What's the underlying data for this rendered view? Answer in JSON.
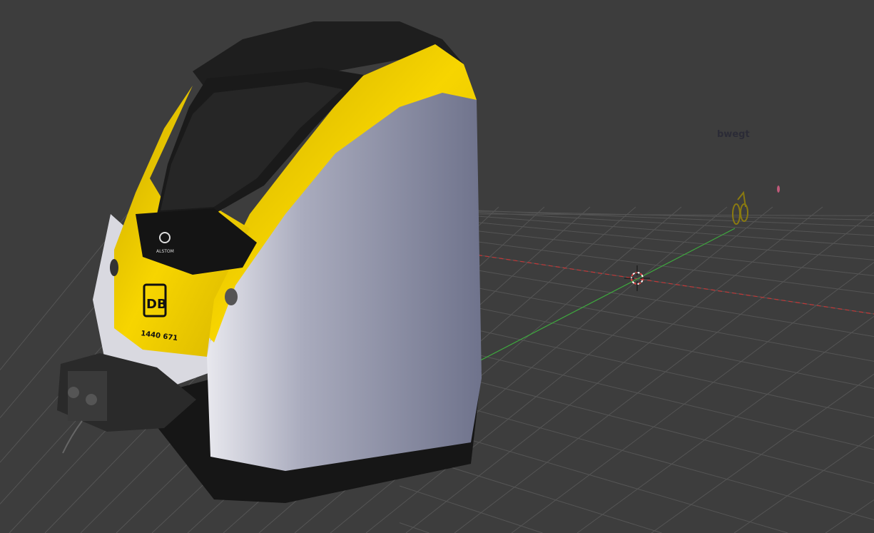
{
  "viewport": {
    "background": "#3d3d3d",
    "grid_color": "#555555",
    "x_axis_color": "#c03838",
    "y_axis_color": "#3ea83e"
  },
  "train": {
    "manufacturer_logo": "ALSTOM",
    "operator_logo": "DB",
    "vehicle_number": "1440 671",
    "colors": {
      "yellow": "#f0cc00",
      "body": "#c8c9d6",
      "black": "#1c1c1c"
    }
  },
  "scene_objects": {
    "background_sign_text": "bwegt"
  },
  "cursor": {
    "name": "3d-cursor"
  }
}
